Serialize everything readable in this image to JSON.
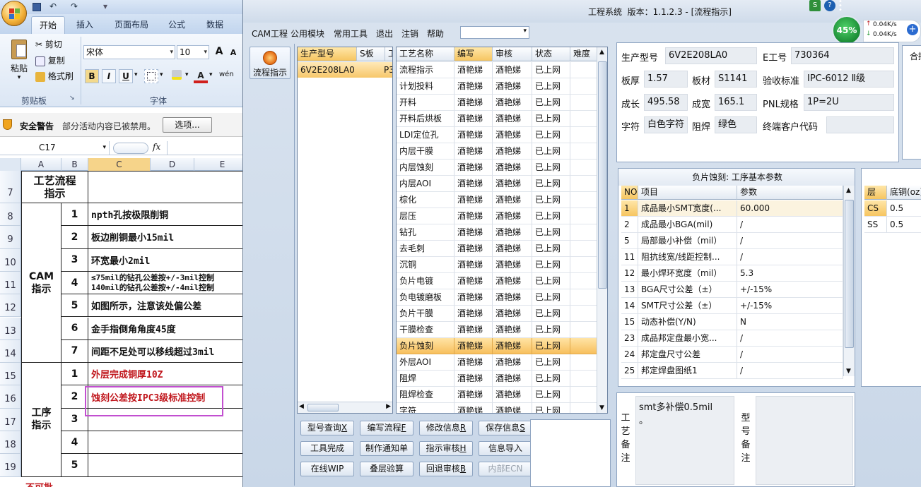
{
  "excel": {
    "qa_undo": "↶",
    "qa_redo": "↷",
    "tabs": [
      "开始",
      "插入",
      "页面布局",
      "公式",
      "数据"
    ],
    "ribbon": {
      "paste": "粘贴",
      "cut": "剪切",
      "copy": "复制",
      "format_painter": "格式刷",
      "clipboard_group": "剪贴板",
      "font_name": "宋体",
      "font_size": "10",
      "font_group": "字体",
      "bold": "B",
      "italic": "I",
      "underline": "U",
      "grow": "A",
      "shrink": "A",
      "wen": "wén"
    },
    "security": {
      "title": "安全警告",
      "message": "部分活动内容已被禁用。",
      "options": "选项..."
    },
    "namebox": "C17",
    "fx": "fx",
    "columns": [
      "A",
      "B",
      "C",
      "D",
      "E"
    ],
    "rows": [
      "7",
      "8",
      "9",
      "10",
      "11",
      "12",
      "13",
      "14",
      "15",
      "16",
      "17",
      "18",
      "19"
    ],
    "header_cell": "工艺流程\n指示",
    "cam_label": "CAM\n指示",
    "process_label": "工序\n指示",
    "cam_items": [
      {
        "n": "1",
        "text": "npth孔按极限削铜"
      },
      {
        "n": "2",
        "text": "板边削铜最小15mil"
      },
      {
        "n": "3",
        "text": "环宽最小2mil"
      },
      {
        "n": "4",
        "text": "≤75mil的钻孔公差按+/-3mil控制\n140mil的钻孔公差按+/-4mil控制"
      },
      {
        "n": "5",
        "text": "如图所示，注意该处偏公差"
      },
      {
        "n": "6",
        "text": "金手指倒角角度45度"
      },
      {
        "n": "7",
        "text": "间距不足处可以移线超过3mil"
      }
    ],
    "process_items": [
      {
        "n": "1",
        "text": "外层完成铜厚10Z"
      },
      {
        "n": "2",
        "text": "蚀刻公差按IPC3级标准控制"
      },
      {
        "n": "3",
        "text": ""
      },
      {
        "n": "4",
        "text": ""
      },
      {
        "n": "5",
        "text": ""
      }
    ],
    "bottom_partial": "不可批"
  },
  "app": {
    "title": "工程系统  版本：1.1.2.3 - [流程指示]",
    "menu": [
      "CAM工程",
      "公用模块",
      "常用工具",
      "退出",
      "注销",
      "帮助"
    ],
    "side_button": "流程指示",
    "net": {
      "percent": "45%",
      "up": "0.04K/s",
      "down": "0.04K/s"
    },
    "model_grid": {
      "headers": [
        "生产型号",
        "S板",
        "工"
      ],
      "row": [
        "6V2E208LA0",
        "",
        "P3"
      ]
    },
    "process_grid": {
      "headers": [
        "工艺名称",
        "编写",
        "审核",
        "状态",
        "难度"
      ],
      "rows": [
        [
          "流程指示",
          "酒艳娣",
          "酒艳娣",
          "已上网"
        ],
        [
          "计划投料",
          "酒艳娣",
          "酒艳娣",
          "已上网"
        ],
        [
          "开料",
          "酒艳娣",
          "酒艳娣",
          "已上网"
        ],
        [
          "开料后烘板",
          "酒艳娣",
          "酒艳娣",
          "已上网"
        ],
        [
          "LDI定位孔",
          "酒艳娣",
          "酒艳娣",
          "已上网"
        ],
        [
          "内层干膜",
          "酒艳娣",
          "酒艳娣",
          "已上网"
        ],
        [
          "内层蚀刻",
          "酒艳娣",
          "酒艳娣",
          "已上网"
        ],
        [
          "内层AOI",
          "酒艳娣",
          "酒艳娣",
          "已上网"
        ],
        [
          "棕化",
          "酒艳娣",
          "酒艳娣",
          "已上网"
        ],
        [
          "层压",
          "酒艳娣",
          "酒艳娣",
          "已上网"
        ],
        [
          "钻孔",
          "酒艳娣",
          "酒艳娣",
          "已上网"
        ],
        [
          "去毛刺",
          "酒艳娣",
          "酒艳娣",
          "已上网"
        ],
        [
          "沉铜",
          "酒艳娣",
          "酒艳娣",
          "已上网"
        ],
        [
          "负片电镀",
          "酒艳娣",
          "酒艳娣",
          "已上网"
        ],
        [
          "负电镀磨板",
          "酒艳娣",
          "酒艳娣",
          "已上网"
        ],
        [
          "负片干膜",
          "酒艳娣",
          "酒艳娣",
          "已上网"
        ],
        [
          "干膜检查",
          "酒艳娣",
          "酒艳娣",
          "已上网"
        ],
        [
          "负片蚀刻",
          "酒艳娣",
          "酒艳娣",
          "已上网"
        ],
        [
          "外层AOI",
          "酒艳娣",
          "酒艳娣",
          "已上网"
        ],
        [
          "阻焊",
          "酒艳娣",
          "酒艳娣",
          "已上网"
        ],
        [
          "阻焊检查",
          "酒艳娣",
          "酒艳娣",
          "已上网"
        ],
        [
          "字符",
          "酒艳娣",
          "酒艳娣",
          "已上网"
        ]
      ],
      "selected_index": 17
    },
    "buttons": [
      {
        "label": "型号查询",
        "key": "X"
      },
      {
        "label": "编写流程",
        "key": "F"
      },
      {
        "label": "修改信息",
        "key": "R"
      },
      {
        "label": "保存信息",
        "key": "S"
      },
      {
        "label": "工具完成",
        "key": ""
      },
      {
        "label": "制作通知单",
        "key": ""
      },
      {
        "label": "指示审核",
        "key": "H"
      },
      {
        "label": "信息导入",
        "key": ""
      },
      {
        "label": "在线WIP",
        "key": ""
      },
      {
        "label": "叠层验算",
        "key": ""
      },
      {
        "label": "回退审核",
        "key": "B"
      },
      {
        "label": "内部ECN",
        "key": ""
      }
    ],
    "info": {
      "model_label": "生产型号",
      "model": "6V2E208LA0",
      "eno_label": "E工号",
      "eno": "730364",
      "thick_label": "板厚",
      "thick": "1.57",
      "material_label": "板材",
      "material": "S1141",
      "standard_label": "验收标准",
      "standard": "IPC-6012 Ⅱ级",
      "length_label": "成长",
      "length": "495.58",
      "width_label": "成宽",
      "width": "165.1",
      "pnl_label": "PNL规格",
      "pnl": "1P=2U",
      "char_label": "字符",
      "char": "白色字符",
      "mask_label": "阻焊",
      "mask": "绿色",
      "customer_label": "终端客户代码",
      "customer": "",
      "right_partial": "合拼"
    },
    "param_panel": {
      "title": "负片蚀刻: 工序基本参数",
      "headers": [
        "NO",
        "项目",
        "参数"
      ],
      "rows": [
        [
          "1",
          "成品最小SMT宽度(...",
          "60.000"
        ],
        [
          "2",
          "成品最小BGA(mil)",
          "/"
        ],
        [
          "5",
          "局部最小补偿（mil）",
          "/"
        ],
        [
          "11",
          "阻抗线宽/线距控制...",
          "/"
        ],
        [
          "12",
          "最小焊环宽度（mil）",
          "5.3"
        ],
        [
          "13",
          "BGA尺寸公差（±）",
          "+/-15%"
        ],
        [
          "14",
          "SMT尺寸公差（±）",
          "+/-15%"
        ],
        [
          "15",
          "动态补偿(Y/N)",
          "N"
        ],
        [
          "23",
          "成品邦定盘最小宽...",
          "/"
        ],
        [
          "24",
          "邦定盘尺寸公差",
          "/"
        ],
        [
          "25",
          "邦定焊盘图纸1",
          "/"
        ]
      ]
    },
    "layer_panel": {
      "headers": [
        "层",
        "底铜(oz)"
      ],
      "rows": [
        [
          "CS",
          "0.5"
        ],
        [
          "SS",
          "0.5"
        ]
      ]
    },
    "remark": {
      "label": "工艺备注",
      "text": "smt多补偿0.5mil\n。",
      "model_label": "型号备注"
    }
  }
}
